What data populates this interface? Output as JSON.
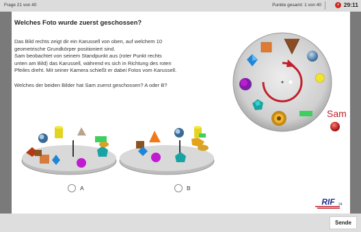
{
  "header": {
    "question_counter": "Frage 21 von 40",
    "points": "Punkte gesamt: 1 von 40",
    "timer": "29:11"
  },
  "question": {
    "title": "Welches Foto wurde zuerst geschossen?",
    "lines": [
      "Das Bild rechts zeigt dir ein Karussell von oben, auf welchem 10",
      "geometrische Grundkörper positioniert sind.",
      "Sam beobachtet von seinem Standpunkt aus (roter Punkt rechts",
      "unten am Bild) das Karussell, während es sich in Richtung des roten",
      "Pfeiles dreht. Mit seiner Kamera schießt er dabei Fotos vom Karussell."
    ],
    "prompt": "Welches der beiden Bilder hat Sam zuerst geschossen? A oder B?"
  },
  "diagram": {
    "observer_label": "Sam"
  },
  "options": {
    "a_label": "A",
    "b_label": "B"
  },
  "logo": {
    "text": "RIF",
    "subscript": "24"
  },
  "footer": {
    "send_label": "Sende"
  },
  "colors": {
    "accent_red": "#c0202a",
    "timer_red": "#d0291f"
  }
}
